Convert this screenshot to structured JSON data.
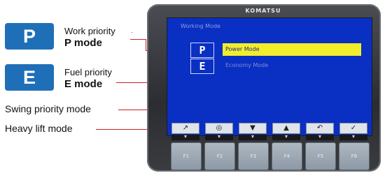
{
  "callouts": {
    "work": {
      "badge": "P",
      "line1": "Work priority",
      "line2": "P mode"
    },
    "fuel": {
      "badge": "E",
      "line1": "Fuel priority",
      "line2": "E mode"
    },
    "swing": "Swing priority mode",
    "heavy": "Heavy lift mode"
  },
  "monitor": {
    "brand": "KOMATSU",
    "screen_title": "Working Mode",
    "modes": [
      {
        "key": "P",
        "label": "Power Mode",
        "selected": true
      },
      {
        "key": "E",
        "label": "Economy Mode",
        "selected": false
      }
    ],
    "softkeys": [
      "↗",
      "◎",
      "▼",
      "▲",
      "↶",
      "✓"
    ],
    "indicator": "▼",
    "fkeys": [
      "F1",
      "F2",
      "F3",
      "F4",
      "F5",
      "F6"
    ]
  },
  "colors": {
    "badge": "#1f6fb8",
    "screen": "#0a2fc3",
    "selected_bar": "#f2ee2a",
    "leader": "#cc2222"
  }
}
